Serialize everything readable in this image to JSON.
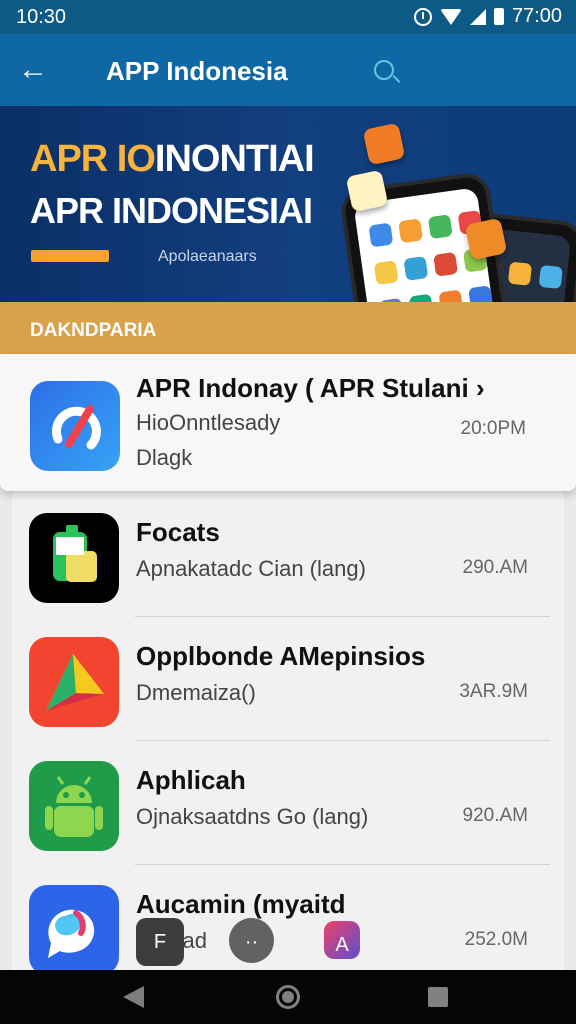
{
  "status_bar": {
    "time": "10:30",
    "right_time": "77:00",
    "icons": [
      "alarm-icon",
      "wifi-icon",
      "signal-icon",
      "battery-icon"
    ]
  },
  "app_bar": {
    "title": "APP Indonesia",
    "back_icon": "arrow-left-icon",
    "search_icon": "search-icon"
  },
  "banner": {
    "line_1_prefix": "APR IO",
    "line_1_suffix": "INONTIAI",
    "line_2": "APR INDONESIAI",
    "subtitle": "Apolaeanaars"
  },
  "section": {
    "title": "DAKNDPARIA"
  },
  "apps": [
    {
      "title": "APR Indonay ( APR Stulani ›",
      "subtitle": "HioOnntlesady",
      "detail": "Dlagk",
      "time": "20:0PM",
      "icon": "refresh-blue-app-icon",
      "colors": [
        "#2d6fe8",
        "#36a3f5",
        "#ef414f"
      ]
    },
    {
      "title": "Focats",
      "subtitle": "Apnakatadc Cian (lang)",
      "time": "290.AM",
      "icon": "battery-app-icon",
      "colors": [
        "#000000",
        "#29c35b",
        "#f1dd66"
      ]
    },
    {
      "title": "Opplbonde AMepinsios",
      "subtitle": "Dmemaiza()",
      "time": "3AR.9M",
      "icon": "play-triangle-app-icon",
      "colors": [
        "#f2442f",
        "#fbbc05",
        "#2bb06a"
      ]
    },
    {
      "title": "Aphlicah",
      "subtitle": "Ojnaksaatdns Go (lang)",
      "time": "920.AM",
      "icon": "android-app-icon",
      "colors": [
        "#1f9b49",
        "#8ed64d"
      ]
    },
    {
      "title": "Aucamin (myaitd",
      "subtitle": "Pn(dad",
      "time": "252.0M",
      "icon": "chat-bubble-app-icon",
      "colors": [
        "#2d65e8",
        "#e33c71",
        "#4fc7f3"
      ]
    }
  ],
  "quick_actions": {
    "menu_label": "F",
    "more_label": "··",
    "brand_label": "A"
  },
  "navigation_icons": [
    "back-triangle-icon",
    "home-circle-icon",
    "recents-square-icon"
  ]
}
